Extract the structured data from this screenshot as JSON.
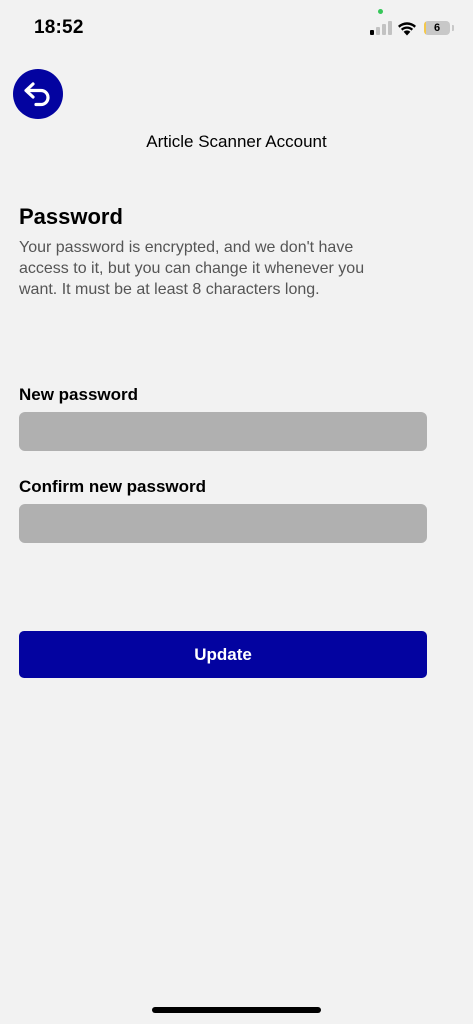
{
  "status_bar": {
    "time": "18:52",
    "battery_level": "6",
    "battery_fraction": 0.06,
    "signal_bars_active": 1,
    "signal_bars_total": 4
  },
  "header": {
    "title": "Article Scanner Account",
    "back_icon": "back-arrow-icon"
  },
  "password_section": {
    "title": "Password",
    "description": "Your password is encrypted, and we don't have access to it, but you can change it whenever you want. It must be at least 8 characters long."
  },
  "form": {
    "new_password_label": "New password",
    "new_password_value": "",
    "confirm_password_label": "Confirm new password",
    "confirm_password_value": "",
    "submit_label": "Update"
  },
  "colors": {
    "accent": "#0303a0",
    "background": "#f2f2f2",
    "input_background": "#b0b0b0",
    "description_text": "#555555"
  }
}
